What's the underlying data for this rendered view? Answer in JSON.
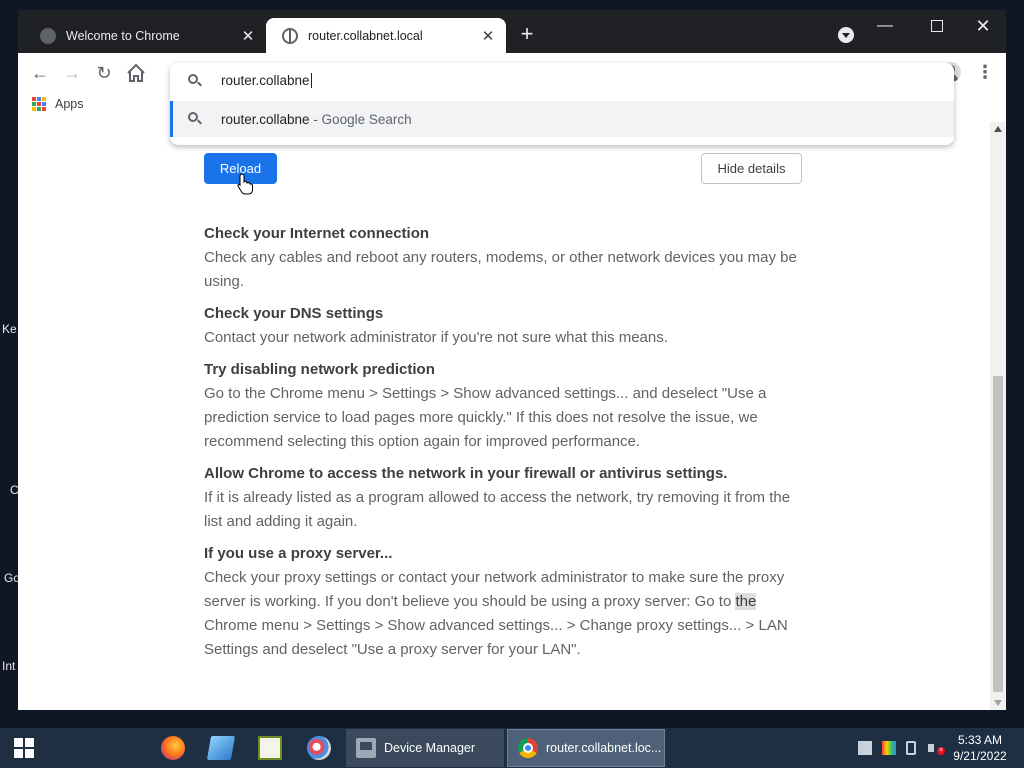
{
  "desktop": {
    "labels": [
      "Ke",
      "C",
      "Go",
      "Int"
    ]
  },
  "browser": {
    "tabs": [
      {
        "title": "Welcome to Chrome",
        "close": "✕",
        "active": false
      },
      {
        "title": "router.collabnet.local",
        "close": "✕",
        "active": true
      }
    ],
    "new_tab": "+",
    "window_controls": {
      "minimize": "—",
      "close": "✕"
    },
    "nav": {
      "back": "←",
      "forward": "→",
      "reload": "↻",
      "menu": "⋮"
    },
    "bookmarks": {
      "apps_label": "Apps",
      "apps_icon_colors": [
        "#ea4335",
        "#4285f4",
        "#fbbc05",
        "#34a853",
        "#ea4335",
        "#4285f4",
        "#fbbc05",
        "#34a853",
        "#ea4335"
      ]
    },
    "omnibox": {
      "typed": "router.collabne",
      "suggestion_text": "router.collabne",
      "suggestion_suffix": " - Google Search"
    }
  },
  "page": {
    "reload_button": "Reload",
    "hide_details_button": "Hide details",
    "suggestions": [
      {
        "title": "Check your Internet connection",
        "text": "Check any cables and reboot any routers, modems, or other network devices you may be using."
      },
      {
        "title": "Check your DNS settings",
        "text": "Contact your network administrator if you're not sure what this means."
      },
      {
        "title": "Try disabling network prediction",
        "text": "Go to the Chrome menu > Settings > Show advanced settings... and deselect \"Use a prediction service to load pages more quickly.\" If this does not resolve the issue, we recommend selecting this option again for improved performance."
      },
      {
        "title": "Allow Chrome to access the network in your firewall or antivirus settings.",
        "text": "If it is already listed as a program allowed to access the network, try removing it from the list and adding it again."
      },
      {
        "title": "If you use a proxy server...",
        "text_before": "Check your proxy settings or contact your network administrator to make sure the proxy server is working. If you don't believe you should be using a proxy server: Go to ",
        "highlighted": "the",
        "text_after": " Chrome menu > Settings > Show advanced settings... > Change proxy settings... > LAN Settings and deselect \"Use a proxy server for your LAN\"."
      }
    ]
  },
  "taskbar": {
    "tasks": [
      {
        "label": "Device Manager"
      },
      {
        "label": "router.collabnet.loc..."
      }
    ],
    "clock": {
      "time": "5:33 AM",
      "date": "9/21/2022"
    }
  },
  "colors": {
    "accent_blue": "#1a73e8",
    "tabstrip": "#202124",
    "taskbar": "#1e2f44"
  }
}
